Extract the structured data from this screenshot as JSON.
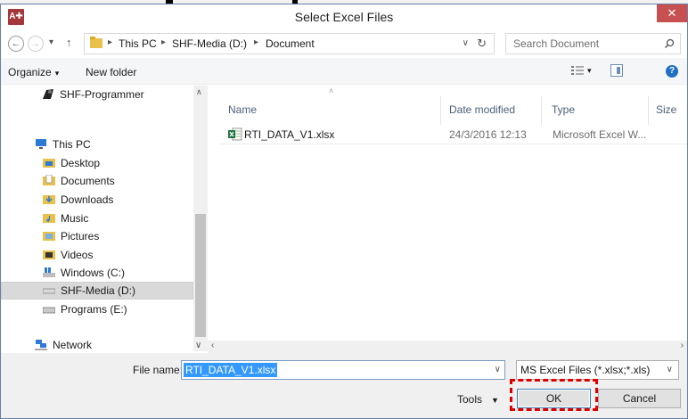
{
  "window": {
    "title": "Select Excel Files",
    "app_icon": "A✚",
    "close_glyph": "✕",
    "accent_color": "#c75050"
  },
  "address": {
    "back_glyph": "←",
    "forward_glyph": "→",
    "recent_glyph": "▾",
    "up_glyph": "↑",
    "sep_glyph": "▸",
    "crumbs": [
      "This PC",
      "SHF-Media (D:)",
      "Document"
    ],
    "dropdown_glyph": "∨",
    "refresh_glyph": "↻",
    "search_placeholder": "Search Document"
  },
  "toolbar": {
    "organize_label": "Organize",
    "organize_dd": "▾",
    "new_folder_label": "New folder",
    "view_dd": "▾",
    "help_glyph": "?"
  },
  "nav": {
    "items": [
      {
        "label": "SHF-Programmer",
        "icon": "user-folder-icon"
      },
      {
        "label": "This PC",
        "icon": "computer-icon"
      },
      {
        "label": "Desktop",
        "icon": "desktop-folder-icon"
      },
      {
        "label": "Documents",
        "icon": "documents-folder-icon"
      },
      {
        "label": "Downloads",
        "icon": "downloads-folder-icon"
      },
      {
        "label": "Music",
        "icon": "music-folder-icon"
      },
      {
        "label": "Pictures",
        "icon": "pictures-folder-icon"
      },
      {
        "label": "Videos",
        "icon": "videos-folder-icon"
      },
      {
        "label": "Windows (C:)",
        "icon": "drive-c-icon"
      },
      {
        "label": "SHF-Media (D:)",
        "icon": "drive-d-icon",
        "selected": true
      },
      {
        "label": "Programs (E:)",
        "icon": "drive-e-icon"
      },
      {
        "label": "Network",
        "icon": "network-icon"
      }
    ],
    "scroll_up": "∧",
    "scroll_down": "∨"
  },
  "files": {
    "columns": [
      "Name",
      "Date modified",
      "Type",
      "Size"
    ],
    "sort_caret": "˄",
    "rows": [
      {
        "name": "RTI_DATA_V1.xlsx",
        "date": "24/3/2016 12:13",
        "type": "Microsoft Excel W..."
      }
    ]
  },
  "scroll": {
    "left": "‹",
    "right": "›",
    "nav_down": "∨"
  },
  "bottom": {
    "file_name_label": "File name:",
    "file_name_value": "RTI_DATA_V1.xlsx",
    "file_name_dd": "∨",
    "filter_value": "MS Excel Files (*.xlsx;*.xls)",
    "filter_dd": "∨",
    "tools_label": "Tools",
    "tools_dd": "▼",
    "ok_label": "OK",
    "cancel_label": "Cancel",
    "highlight_color": "#e00000"
  }
}
